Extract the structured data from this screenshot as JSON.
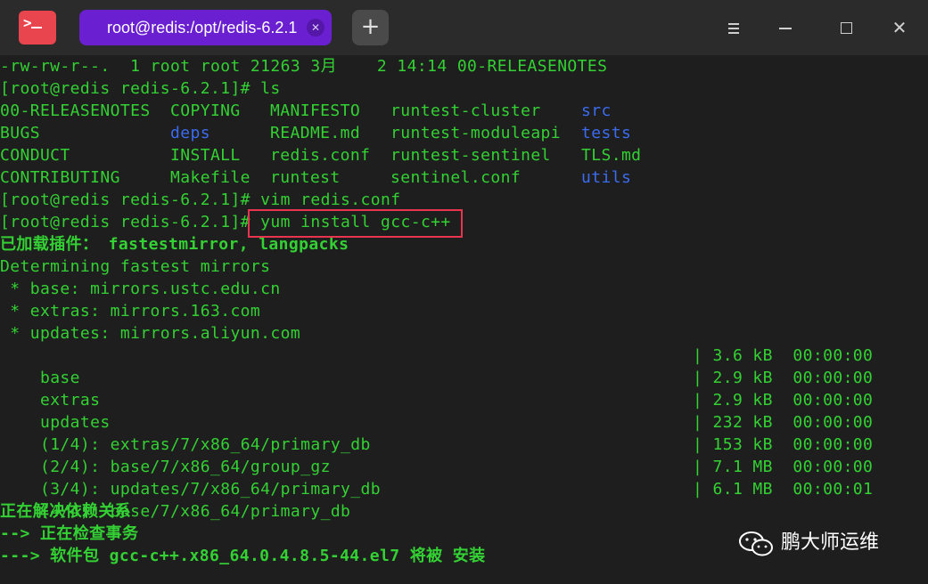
{
  "window": {
    "tab_title": "root@redis:/opt/redis-6.2.1",
    "tab_close": "✕",
    "new_tab": "+",
    "close": "✕"
  },
  "terminal": {
    "lines": [
      {
        "text": "-rw-rw-r--.  1 root root 21263 3月    2 14:14 00-RELEASENOTES",
        "color": "#33d133"
      },
      {
        "text": "[root@redis redis-6.2.1]# ls",
        "color": "#33d133"
      },
      {
        "text": "[root@redis redis-6.2.1]# vim redis.conf",
        "color": "#33d133"
      },
      {
        "text": "[root@redis redis-6.2.1]# yum install gcc-c++",
        "color": "#33d133"
      },
      {
        "text": "已加载插件： fastestmirror, langpacks",
        "color": "#33d133"
      },
      {
        "text": "Determining fastest mirrors",
        "color": "#33d133"
      },
      {
        "text": " * base: mirrors.ustc.edu.cn",
        "color": "#33d133"
      },
      {
        "text": " * extras: mirrors.163.com",
        "color": "#33d133"
      },
      {
        "text": " * updates: mirrors.aliyun.com",
        "color": "#33d133"
      },
      {
        "text": "正在解决依赖关系",
        "color": "#33d133"
      },
      {
        "text": "--> 正在检查事务",
        "color": "#33d133"
      },
      {
        "text": "---> 软件包 gcc-c++.x86_64.0.4.8.5-44.el7 将被 安装",
        "color": "#33d133"
      }
    ],
    "ls_output": [
      [
        "00-RELEASENOTES",
        "COPYING",
        "MANIFESTO",
        "runtest-cluster",
        "src"
      ],
      [
        "BUGS",
        "deps",
        "README.md",
        "runtest-moduleapi",
        "tests"
      ],
      [
        "CONDUCT",
        "INSTALL",
        "redis.conf",
        "runtest-sentinel",
        "TLS.md"
      ],
      [
        "CONTRIBUTING",
        "Makefile",
        "runtest",
        "sentinel.conf",
        "utils"
      ]
    ],
    "downloads": [
      {
        "name": "base",
        "size": "| 3.6 kB",
        "time": "00:00:00"
      },
      {
        "name": "extras",
        "size": "| 2.9 kB",
        "time": "00:00:00"
      },
      {
        "name": "updates",
        "size": "| 2.9 kB",
        "time": "00:00:00"
      },
      {
        "name": "(1/4): extras/7/x86_64/primary_db",
        "size": "| 232 kB",
        "time": "00:00:00"
      },
      {
        "name": "(2/4): base/7/x86_64/group_gz",
        "size": "| 153 kB",
        "time": "00:00:00"
      },
      {
        "name": "(3/4): updates/7/x86_64/primary_db",
        "size": "| 7.1 MB",
        "time": "00:00:00"
      },
      {
        "name": "(4/4): base/7/x86_64/primary_db",
        "size": "| 6.1 MB",
        "time": "00:00:01"
      }
    ]
  },
  "watermark": {
    "text": "鹏大师运维"
  },
  "colors": {
    "text_green": "#33d133",
    "dir_blue": "#3b6cf0",
    "highlight_red": "#e8344e",
    "tab_purple": "#6a1fd1"
  }
}
